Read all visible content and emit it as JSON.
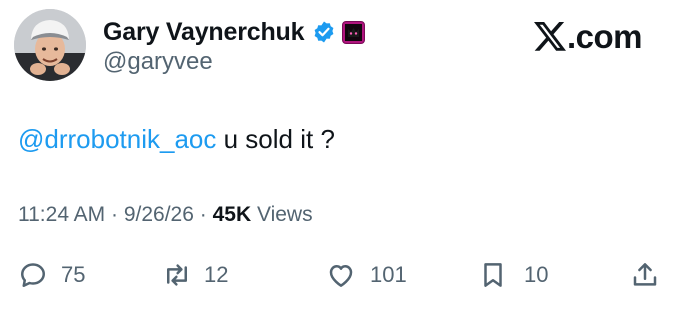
{
  "author": {
    "display_name": "Gary Vaynerchuk",
    "handle": "@garyvee",
    "verified_color": "#1d9bf0",
    "affiliate_badge_color": "#b0147e"
  },
  "brand": {
    "logo_text": ".com",
    "logo_icon": "x-logo-icon"
  },
  "tweet": {
    "mention": "@drrobotnik_aoc",
    "text": " u sold it ?"
  },
  "meta": {
    "time": "11:24 AM",
    "sep1": " · ",
    "date": "9/26/26",
    "sep2": " · ",
    "views_count": "45K",
    "views_label": " Views"
  },
  "actions": {
    "replies": "75",
    "reposts": "12",
    "likes": "101",
    "bookmarks": "10"
  },
  "colors": {
    "link": "#1d9bf0",
    "secondary_text": "#536471",
    "primary_text": "#0f1419"
  }
}
